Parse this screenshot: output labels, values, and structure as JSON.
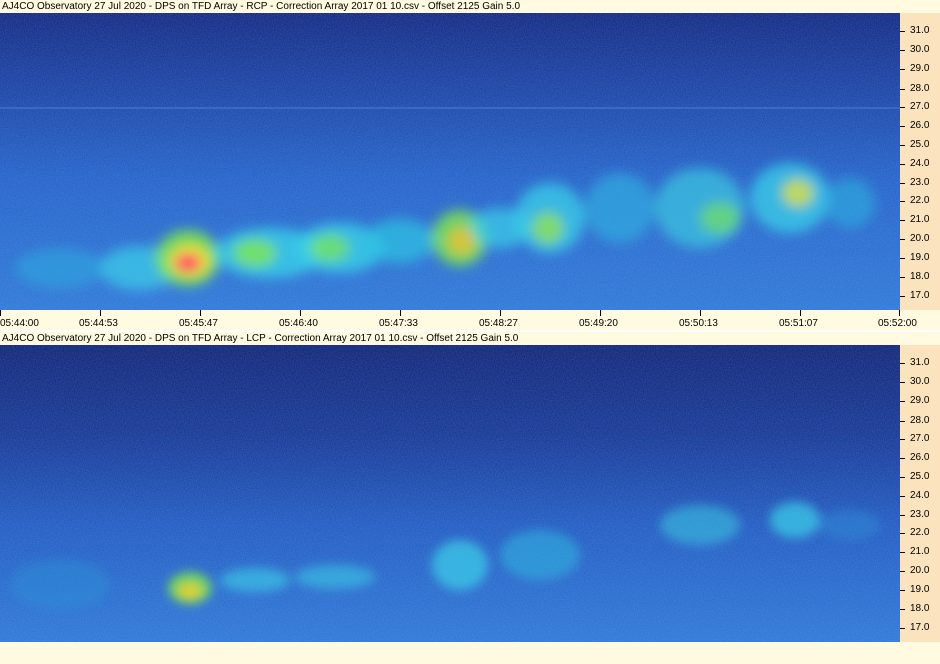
{
  "window": {
    "rcp_title": "AJ4CO Observatory 27 Jul 2020  -  DPS on TFD Array  -  RCP  -  Correction Array 2017 01 10.csv  -  Offset 2125  Gain 5.0",
    "lcp_title": "AJ4CO Observatory 27 Jul 2020  -  DPS on TFD Array  -  LCP  -  Correction Array 2017 01 10.csv  -  Offset 2125  Gain 5.0"
  },
  "frequency_axis": {
    "labels": [
      "31.0",
      "30.0",
      "29.0",
      "28.0",
      "27.0",
      "26.0",
      "25.0",
      "24.0",
      "23.0",
      "22.0",
      "21.0",
      "20.0",
      "19.0",
      "18.0",
      "17.0"
    ]
  },
  "time_axis": {
    "labels": [
      "05:44:00",
      "05:44:53",
      "05:45:47",
      "05:46:40",
      "05:47:33",
      "05:48:27",
      "05:49:20",
      "05:50:13",
      "05:51:07",
      "05:52:00"
    ]
  },
  "colors": {
    "background_deep": "#0a1a6e",
    "background_mid": "#1c50b8",
    "emission_cyan": "#3ad0e8",
    "emission_green": "#7ee850",
    "emission_yellow": "#f0e030",
    "emission_red": "#ff3a6a",
    "axis_bg": "#fbe3bd",
    "title_bg": "#fffae0"
  }
}
